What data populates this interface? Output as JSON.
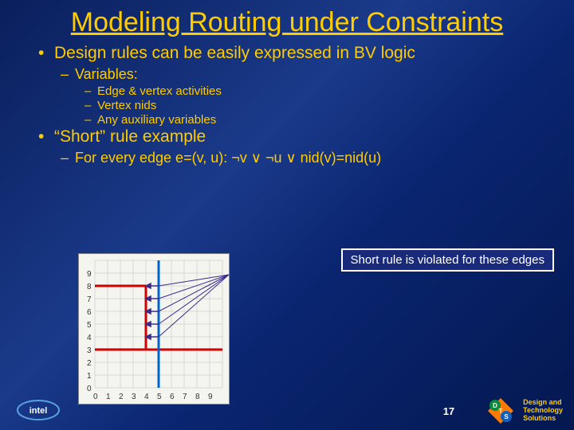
{
  "title": "Modeling Routing under Constraints",
  "bullets": {
    "b1": "Design rules can be easily expressed in BV logic",
    "b1a": "Variables:",
    "b1a1": "Edge & vertex activities",
    "b1a2": "Vertex nids",
    "b1a3": "Any auxiliary variables",
    "b2": "“Short” rule example",
    "b2a": "For every edge e=(v, u): ¬v ∨ ¬u ∨ nid(v)=nid(u)"
  },
  "callout": "Short rule is violated for these edges",
  "pagenum": "17",
  "footer": {
    "org1": "Design and",
    "org2": "Technology",
    "org3": "Solutions"
  },
  "chart_data": {
    "type": "diagram",
    "grid": {
      "xmin": 0,
      "xmax": 9,
      "ymin": 0,
      "ymax": 9
    },
    "x_ticks": [
      0,
      1,
      2,
      3,
      4,
      5,
      6,
      7,
      8,
      9
    ],
    "y_ticks": [
      0,
      1,
      2,
      3,
      4,
      5,
      6,
      7,
      8,
      9
    ],
    "wires": [
      {
        "name": "red-horizontal-lower",
        "points": [
          [
            0,
            3
          ],
          [
            9,
            3
          ]
        ],
        "color": "#d00"
      },
      {
        "name": "red-horizontal-upper",
        "points": [
          [
            0,
            8
          ],
          [
            4,
            8
          ]
        ],
        "color": "#d00"
      },
      {
        "name": "red-vertical",
        "points": [
          [
            4,
            3
          ],
          [
            4,
            8
          ]
        ],
        "color": "#d00"
      },
      {
        "name": "blue-vertical",
        "points": [
          [
            5,
            0
          ],
          [
            5,
            9
          ]
        ],
        "color": "#06c"
      }
    ],
    "violations": [
      {
        "edge": [
          [
            4,
            4
          ],
          [
            5,
            4
          ]
        ]
      },
      {
        "edge": [
          [
            4,
            5
          ],
          [
            5,
            5
          ]
        ]
      },
      {
        "edge": [
          [
            4,
            6
          ],
          [
            5,
            6
          ]
        ]
      },
      {
        "edge": [
          [
            4,
            7
          ],
          [
            5,
            7
          ]
        ]
      },
      {
        "edge": [
          [
            4,
            8
          ],
          [
            5,
            8
          ]
        ]
      }
    ],
    "callout_anchor": [
      7.5,
      6
    ]
  }
}
